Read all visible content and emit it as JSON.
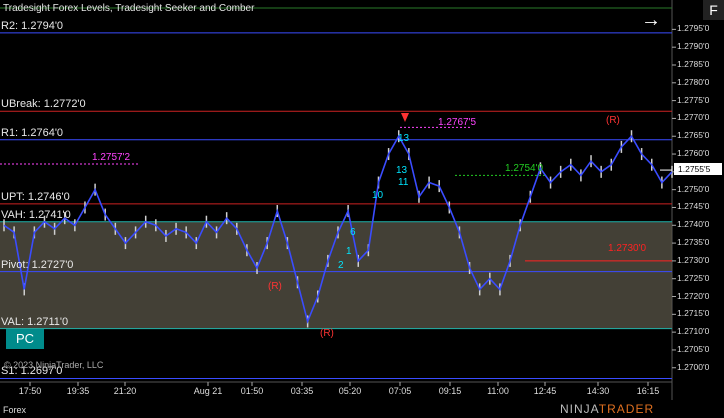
{
  "title": "Tradesight Forex Levels, Tradesight Seeker and Comber",
  "tab_label": "Forex",
  "copyright": "© 2023 NinjaTrader, LLC",
  "pc_label": "PC",
  "f_label": "F",
  "brand": {
    "a": "NINJA",
    "b": "TRADER"
  },
  "current_price": "1.2755'5",
  "colors": {
    "area": "#5a5648",
    "price": "#cfcfcf",
    "ma": "#3a4cff",
    "seeker": "#00ff00"
  },
  "levels": [
    {
      "id": "r2",
      "label": "R2: 1.2794'0",
      "price": 1.2794,
      "color": "#3a4cff"
    },
    {
      "id": "ubreak",
      "label": "UBreak: 1.2772'0",
      "price": 1.2772,
      "color": "#cc2222"
    },
    {
      "id": "r1",
      "label": "R1: 1.2764'0",
      "price": 1.2764,
      "color": "#3a4cff"
    },
    {
      "id": "upt",
      "label": "UPT: 1.2746'0",
      "price": 1.2746,
      "color": "#cc2222"
    },
    {
      "id": "vah",
      "label": "VAH: 1.2741'0",
      "price": 1.2741,
      "color": "#20b2aa"
    },
    {
      "id": "pivot",
      "label": "Pivot: 1.2727'0",
      "price": 1.2727,
      "color": "#3a4cff"
    },
    {
      "id": "val",
      "label": "VAL: 1.2711'0",
      "price": 1.2711,
      "color": "#20b2aa"
    },
    {
      "id": "s1",
      "label": "S1: 1.2697'0",
      "price": 1.2697,
      "color": "#3a4cff"
    }
  ],
  "annotations": [
    {
      "text": "1.2757'2",
      "color": "#ff44ff"
    },
    {
      "text": "1.2767'5",
      "color": "#ff44ff"
    },
    {
      "text": "1.2754'0",
      "color": "#22cc22"
    },
    {
      "text": "1.2730'0",
      "color": "#ff2222"
    },
    {
      "text": "(R)",
      "color": "#ff3333"
    },
    {
      "text": "(R)",
      "color": "#ff3333"
    },
    {
      "text": "(R)",
      "color": "#ff3333"
    },
    {
      "text": "10",
      "color": "#00e5ff"
    },
    {
      "text": "13",
      "color": "#00e5ff"
    },
    {
      "text": "13",
      "color": "#00e5ff"
    },
    {
      "text": "11",
      "color": "#00e5ff"
    },
    {
      "text": "6",
      "color": "#00e5ff"
    },
    {
      "text": "2",
      "color": "#00e5ff"
    },
    {
      "text": "1",
      "color": "#00e5ff"
    }
  ],
  "chart_data": {
    "type": "line",
    "ylim": [
      1.2696,
      1.2801
    ],
    "y_ticks": [
      "1.2795'0",
      "1.2790'0",
      "1.2785'0",
      "1.2780'0",
      "1.2775'0",
      "1.2770'0",
      "1.2765'0",
      "1.2760'0",
      "1.2755'0",
      "1.2750'0",
      "1.2745'0",
      "1.2740'0",
      "1.2735'0",
      "1.2730'0",
      "1.2725'0",
      "1.2720'0",
      "1.2715'0",
      "1.2710'0",
      "1.2705'0",
      "1.2700'0"
    ],
    "x_ticks": [
      "17:50",
      "19:35",
      "21:20",
      "Aug 21",
      "01:50",
      "03:35",
      "05:20",
      "07:05",
      "09:15",
      "11:00",
      "12:45",
      "14:30",
      "16:15"
    ],
    "series": [
      {
        "values": [
          1.274,
          1.2738,
          1.2722,
          1.2738,
          1.2741,
          1.2739,
          1.2742,
          1.274,
          1.2745,
          1.275,
          1.2743,
          1.2739,
          1.2735,
          1.2738,
          1.2741,
          1.274,
          1.2737,
          1.2739,
          1.2738,
          1.2735,
          1.2741,
          1.2738,
          1.2742,
          1.2739,
          1.2733,
          1.2728,
          1.2735,
          1.2744,
          1.2735,
          1.2724,
          1.2713,
          1.272,
          1.273,
          1.2738,
          1.2744,
          1.273,
          1.2733,
          1.2752,
          1.276,
          1.2765,
          1.276,
          1.2748,
          1.2752,
          1.2751,
          1.2745,
          1.2738,
          1.2728,
          1.2722,
          1.2725,
          1.2722,
          1.273,
          1.274,
          1.2748,
          1.2756,
          1.2752,
          1.2755,
          1.2757,
          1.2754,
          1.2758,
          1.2755,
          1.2757,
          1.2762,
          1.2765,
          1.276,
          1.2757,
          1.2752,
          1.2755
        ]
      }
    ]
  }
}
